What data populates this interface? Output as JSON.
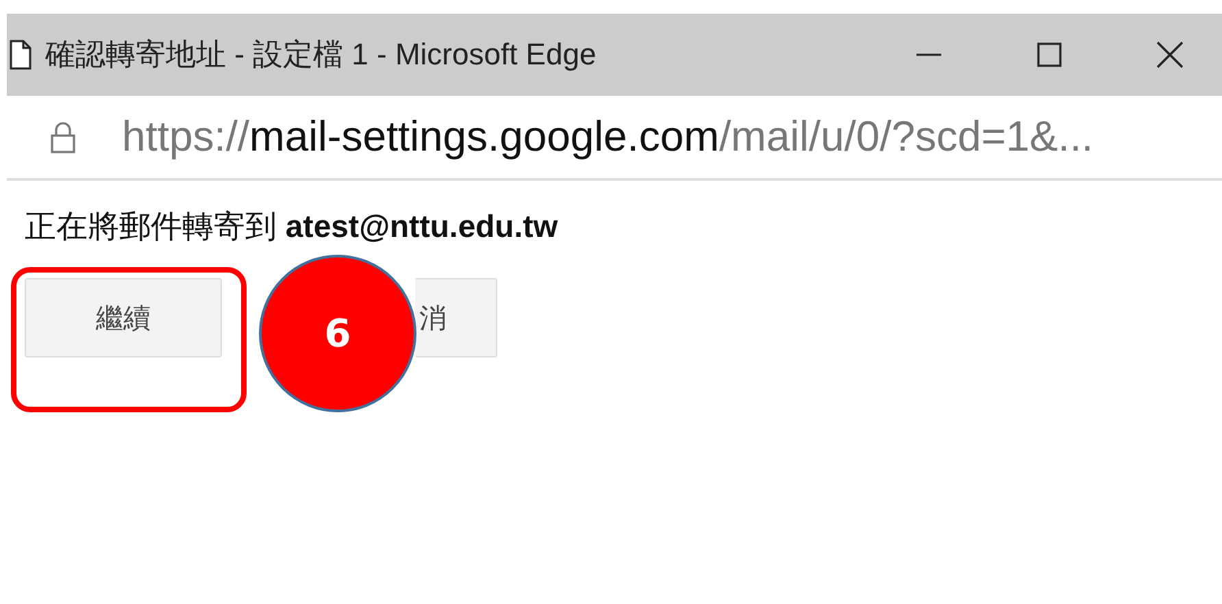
{
  "window": {
    "title": "確認轉寄地址 - 設定檔 1 - Microsoft Edge"
  },
  "address_bar": {
    "scheme": "https://",
    "host": "mail-settings.google.com",
    "path": "/mail/u/0/?scd=1&..."
  },
  "message": "正在將郵件轉寄到 **atest@nttu.edu.tw**",
  "buttons": [
    "繼續",
    "消"
  ],
  "annotation": {
    "number": "6"
  }
}
